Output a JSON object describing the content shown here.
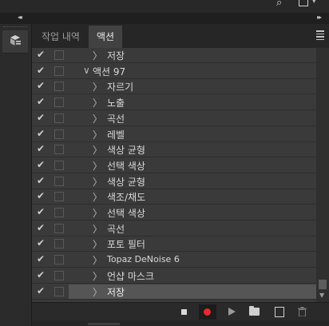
{
  "panel": {
    "tabs": [
      {
        "label": "작업 내역",
        "active": false
      },
      {
        "label": "액션",
        "active": true
      }
    ]
  },
  "actions": [
    {
      "check": "✔",
      "indent": 1,
      "expanded": false,
      "label": "저장",
      "selected": false
    },
    {
      "check": "✔",
      "indent": 0,
      "expanded": true,
      "label": "액션 97",
      "selected": false
    },
    {
      "check": "✔",
      "indent": 1,
      "expanded": false,
      "label": "자르기",
      "selected": false
    },
    {
      "check": "✔",
      "indent": 1,
      "expanded": false,
      "label": "노출",
      "selected": false
    },
    {
      "check": "✔",
      "indent": 1,
      "expanded": false,
      "label": "곡선",
      "selected": false
    },
    {
      "check": "✔",
      "indent": 1,
      "expanded": false,
      "label": "레벨",
      "selected": false
    },
    {
      "check": "✔",
      "indent": 1,
      "expanded": false,
      "label": "색상 균형",
      "selected": false
    },
    {
      "check": "✔",
      "indent": 1,
      "expanded": false,
      "label": "선택 색상",
      "selected": false
    },
    {
      "check": "✔",
      "indent": 1,
      "expanded": false,
      "label": "색상 균형",
      "selected": false
    },
    {
      "check": "✔",
      "indent": 1,
      "expanded": false,
      "label": "색조/채도",
      "selected": false
    },
    {
      "check": "✔",
      "indent": 1,
      "expanded": false,
      "label": "선택 색상",
      "selected": false
    },
    {
      "check": "✔",
      "indent": 1,
      "expanded": false,
      "label": "곡선",
      "selected": false
    },
    {
      "check": "✔",
      "indent": 1,
      "expanded": false,
      "label": "포토 필터",
      "selected": false
    },
    {
      "check": "✔",
      "indent": 1,
      "expanded": false,
      "label": "Topaz DeNoise 6",
      "selected": false,
      "small": true
    },
    {
      "check": "✔",
      "indent": 1,
      "expanded": false,
      "label": "언샵 마스크",
      "selected": false
    },
    {
      "check": "✔",
      "indent": 1,
      "expanded": false,
      "label": "저장",
      "selected": true
    }
  ],
  "glyphs": {
    "collapsed": "〉",
    "expanded": "∨",
    "collapse_left": "◂◂",
    "collapse_right": "▸▸",
    "search": "⌕",
    "chevron_down": "▾",
    "scroll_down": "▼"
  },
  "colors": {
    "record": "#e8282b",
    "panel_bg": "#3a3a3a",
    "selected_row": "#555555"
  }
}
